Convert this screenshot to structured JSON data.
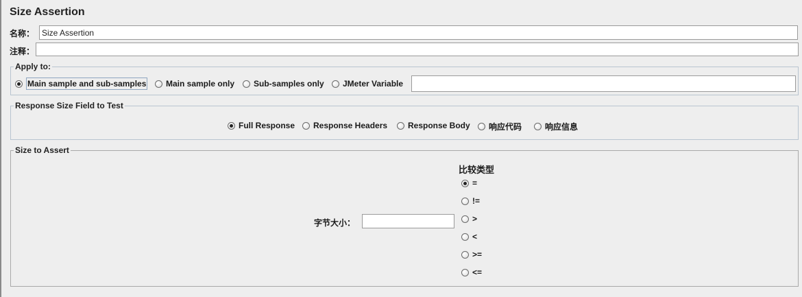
{
  "title": "Size Assertion",
  "name_label": "名称：",
  "name_value": "Size Assertion",
  "comment_label": "注释：",
  "comment_value": "",
  "apply_to": {
    "legend": "Apply to:",
    "options": [
      "Main sample and sub-samples",
      "Main sample only",
      "Sub-samples only",
      "JMeter Variable"
    ],
    "selected": "Main sample and sub-samples",
    "variable_value": ""
  },
  "response_field": {
    "legend": "Response Size Field to Test",
    "options": [
      "Full Response",
      "Response Headers",
      "Response Body",
      "响应代码",
      "响应信息"
    ],
    "selected": "Full Response"
  },
  "size_to_assert": {
    "legend": "Size to Assert",
    "size_label": "字节大小：",
    "size_value": "",
    "comparison_label": "比较类型",
    "comparison_options": [
      "=",
      "!=",
      ">",
      "<",
      ">=",
      "<="
    ],
    "comparison_selected": "="
  }
}
